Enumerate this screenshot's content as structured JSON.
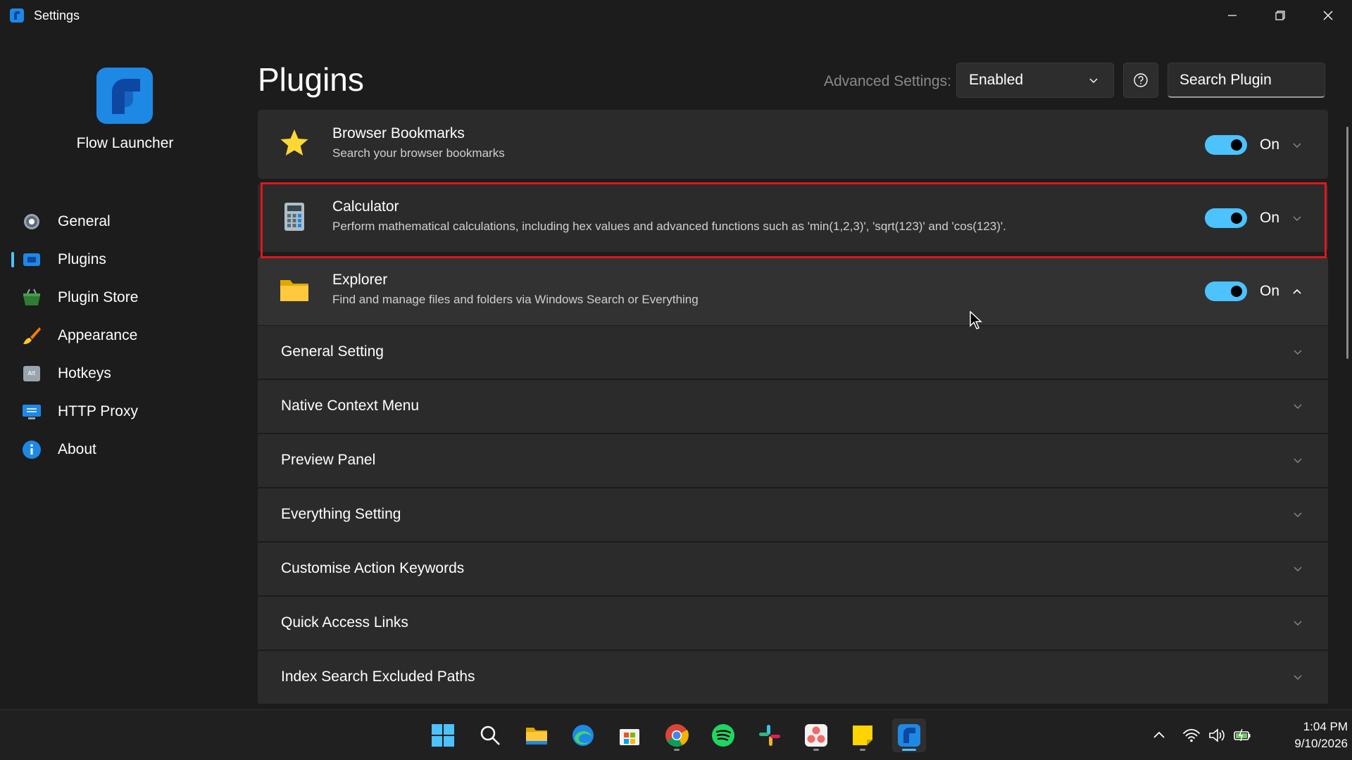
{
  "window": {
    "title": "Settings"
  },
  "sidebar": {
    "app_name": "Flow Launcher",
    "items": [
      {
        "label": "General",
        "icon": "gear-icon",
        "active": false
      },
      {
        "label": "Plugins",
        "icon": "plugin-icon",
        "active": true
      },
      {
        "label": "Plugin Store",
        "icon": "basket-icon",
        "active": false
      },
      {
        "label": "Appearance",
        "icon": "brush-icon",
        "active": false
      },
      {
        "label": "Hotkeys",
        "icon": "alt-key-icon",
        "active": false
      },
      {
        "label": "HTTP Proxy",
        "icon": "proxy-icon",
        "active": false
      },
      {
        "label": "About",
        "icon": "info-icon",
        "active": false
      }
    ]
  },
  "header": {
    "title": "Plugins",
    "advanced_label": "Advanced Settings:",
    "advanced_value": "Enabled",
    "search_placeholder": "Search Plugin"
  },
  "plugins": [
    {
      "name": "Browser Bookmarks",
      "description": "Search your browser bookmarks",
      "state": "On",
      "icon": "star-icon"
    },
    {
      "name": "Calculator",
      "description": "Perform mathematical calculations, including hex values and advanced functions such as 'min(1,2,3)', 'sqrt(123)' and 'cos(123)'.",
      "state": "On",
      "icon": "calculator-icon"
    },
    {
      "name": "Explorer",
      "description": "Find and manage files and folders via Windows Search or Everything",
      "state": "On",
      "icon": "folder-icon"
    }
  ],
  "explorer_settings": [
    "General Setting",
    "Native Context Menu",
    "Preview Panel",
    "Everything Setting",
    "Customise Action Keywords",
    "Quick Access Links",
    "Index Search Excluded Paths"
  ],
  "taskbar": {
    "apps": [
      "windows-start-icon",
      "search-icon",
      "file-explorer-icon",
      "edge-icon",
      "microsoft-store-icon",
      "chrome-icon",
      "spotify-icon",
      "slack-icon",
      "asana-icon",
      "sticky-notes-icon",
      "flow-launcher-icon"
    ],
    "time": "1:04 PM",
    "date": "9/10/2026"
  },
  "colors": {
    "accent": "#4cc2ff",
    "highlight_border": "#e0161e",
    "background": "#1c1c1c",
    "card": "#2b2b2b"
  }
}
